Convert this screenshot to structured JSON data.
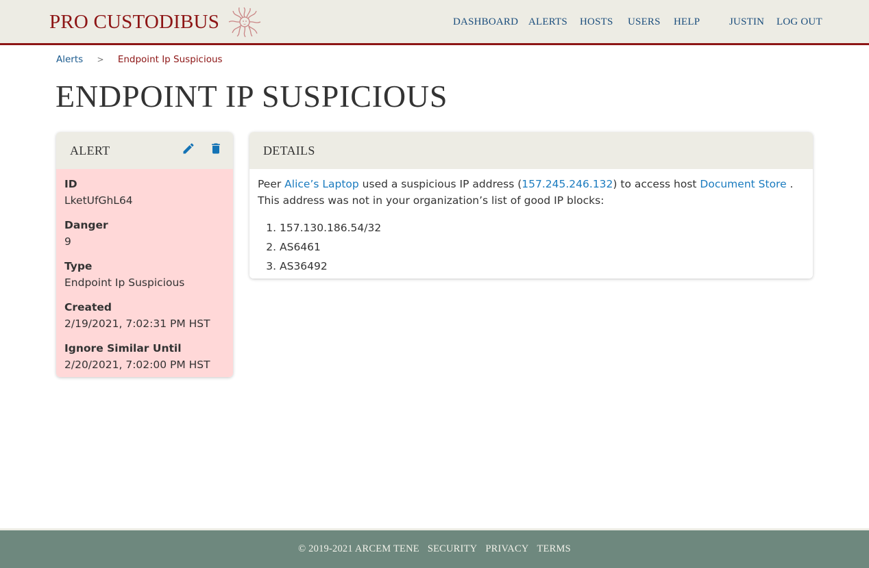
{
  "header": {
    "brand": "PRO CUSTODIBUS",
    "logo_icon": "medusa-logo-icon",
    "nav": [
      {
        "label": "DASHBOARD"
      },
      {
        "label": "ALERTS"
      },
      {
        "label": "HOSTS"
      },
      {
        "label": "USERS"
      },
      {
        "label": "HELP"
      }
    ],
    "user": "JUSTIN",
    "logout": "LOG OUT"
  },
  "breadcrumb": {
    "parent": "Alerts",
    "separator": ">",
    "current": "Endpoint Ip Suspicious"
  },
  "page_title": "ENDPOINT IP SUSPICIOUS",
  "alert_card": {
    "title": "ALERT",
    "edit_icon": "pencil-icon",
    "delete_icon": "trash-icon",
    "fields": [
      {
        "label": "ID",
        "value": "LketUfGhL64"
      },
      {
        "label": "Danger",
        "value": "9"
      },
      {
        "label": "Type",
        "value": "Endpoint Ip Suspicious"
      },
      {
        "label": "Created",
        "value": "2/19/2021, 7:02:31 PM HST"
      },
      {
        "label": "Ignore Similar Until",
        "value": "2/20/2021, 7:02:00 PM HST"
      }
    ]
  },
  "details_card": {
    "title": "DETAILS",
    "text_1": "Peer ",
    "peer_link": "Alice’s Laptop",
    "text_2": " used a suspicious IP address (",
    "ip_link": "157.245.246.132",
    "text_3": ") to access host ",
    "host_link": "Document Store",
    "text_4": " . This address was not in your organization’s list of good IP blocks:",
    "ip_blocks": [
      "157.130.186.54/32",
      "AS6461",
      "AS36492"
    ]
  },
  "footer": {
    "copyright": "© 2019-2021 ARCEM TENE",
    "links": [
      "SECURITY",
      "PRIVACY",
      "TERMS"
    ]
  },
  "colors": {
    "brand_red": "#8d1515",
    "nav_blue": "#1a4d7c",
    "link_blue": "#1a7bbf",
    "header_bg": "#edece4",
    "alert_bg": "#ffd8d8",
    "footer_bg": "#6e887e",
    "icon_blue": "#1473b5"
  }
}
